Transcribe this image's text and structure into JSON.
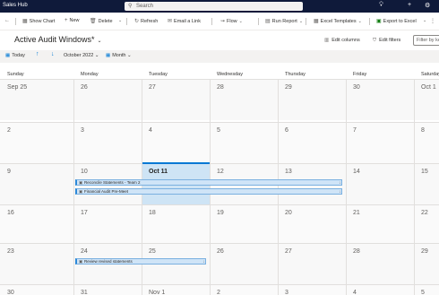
{
  "appbar": {
    "title": "Sales Hub",
    "search_placeholder": "Search"
  },
  "commands": {
    "back": "←",
    "show_chart": "Show Chart",
    "new": "New",
    "delete": "Delete",
    "refresh": "Refresh",
    "email_link": "Email a Link",
    "flow": "Flow",
    "run_report": "Run Report",
    "excel_templates": "Excel Templates",
    "export_excel": "Export to Excel"
  },
  "view": {
    "title": "Active Audit Windows*",
    "edit_columns": "Edit columns",
    "edit_filters": "Edit filters",
    "filter_placeholder": "Filter by ke"
  },
  "calendar_toolbar": {
    "today": "Today",
    "period": "October 2022",
    "mode": "Month"
  },
  "weekdays": [
    "Sunday",
    "Monday",
    "Tuesday",
    "Wednesday",
    "Thursday",
    "Friday",
    "Saturday"
  ],
  "weeks": [
    [
      "Sep 25",
      "26",
      "27",
      "28",
      "29",
      "30",
      "Oct 1"
    ],
    [
      "2",
      "3",
      "4",
      "5",
      "6",
      "7",
      "8"
    ],
    [
      "9",
      "10",
      "Oct 11",
      "12",
      "13",
      "14",
      "15"
    ],
    [
      "16",
      "17",
      "18",
      "19",
      "20",
      "21",
      "22"
    ],
    [
      "23",
      "24",
      "25",
      "26",
      "27",
      "28",
      "29"
    ],
    [
      "30",
      "31",
      "Nov 1",
      "2",
      "3",
      "4",
      "5"
    ]
  ],
  "events": [
    {
      "title": "Reconcile Statements - Team 2"
    },
    {
      "title": "Financial Audit Pre-Meet"
    },
    {
      "title": "Review revised statements"
    }
  ]
}
